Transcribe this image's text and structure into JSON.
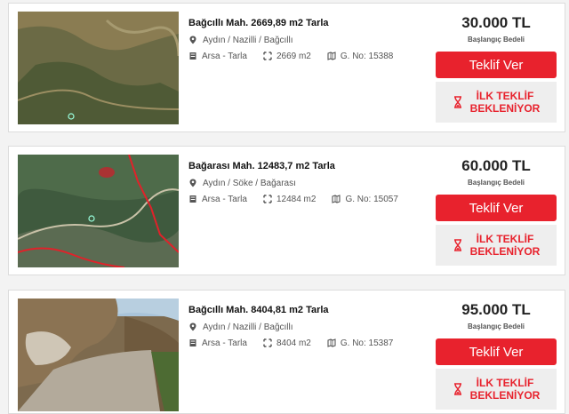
{
  "listings": [
    {
      "title": "Bağcıllı Mah. 2669,89 m2 Tarla",
      "location": "Aydın / Nazilli / Bağcıllı",
      "type": "Arsa - Tarla",
      "area": "2669 m2",
      "parcel": "G. No: 15388",
      "price": "30.000 TL",
      "price_label": "Başlangıç Bedeli",
      "bid_label": "Teklif Ver",
      "status_line1": "İLK TEKLİF",
      "status_line2": "BEKLENİYOR"
    },
    {
      "title": "Bağarası Mah. 12483,7 m2 Tarla",
      "location": "Aydın / Söke / Bağarası",
      "type": "Arsa - Tarla",
      "area": "12484 m2",
      "parcel": "G. No: 15057",
      "price": "60.000 TL",
      "price_label": "Başlangıç Bedeli",
      "bid_label": "Teklif Ver",
      "status_line1": "İLK TEKLİF",
      "status_line2": "BEKLENİYOR"
    },
    {
      "title": "Bağcıllı Mah. 8404,81 m2 Tarla",
      "location": "Aydın / Nazilli / Bağcıllı",
      "type": "Arsa - Tarla",
      "area": "8404 m2",
      "parcel": "G. No: 15387",
      "price": "95.000 TL",
      "price_label": "Başlangıç Bedeli",
      "bid_label": "Teklif Ver",
      "status_line1": "İLK TEKLİF",
      "status_line2": "BEKLENİYOR"
    }
  ],
  "icons": {
    "location": "map-pin-icon",
    "type": "building-icon",
    "area": "area-arrows-icon",
    "parcel": "parcel-map-icon",
    "status": "hourglass-icon"
  },
  "colors": {
    "accent": "#e8222d",
    "status_bg": "#eeeeee"
  }
}
